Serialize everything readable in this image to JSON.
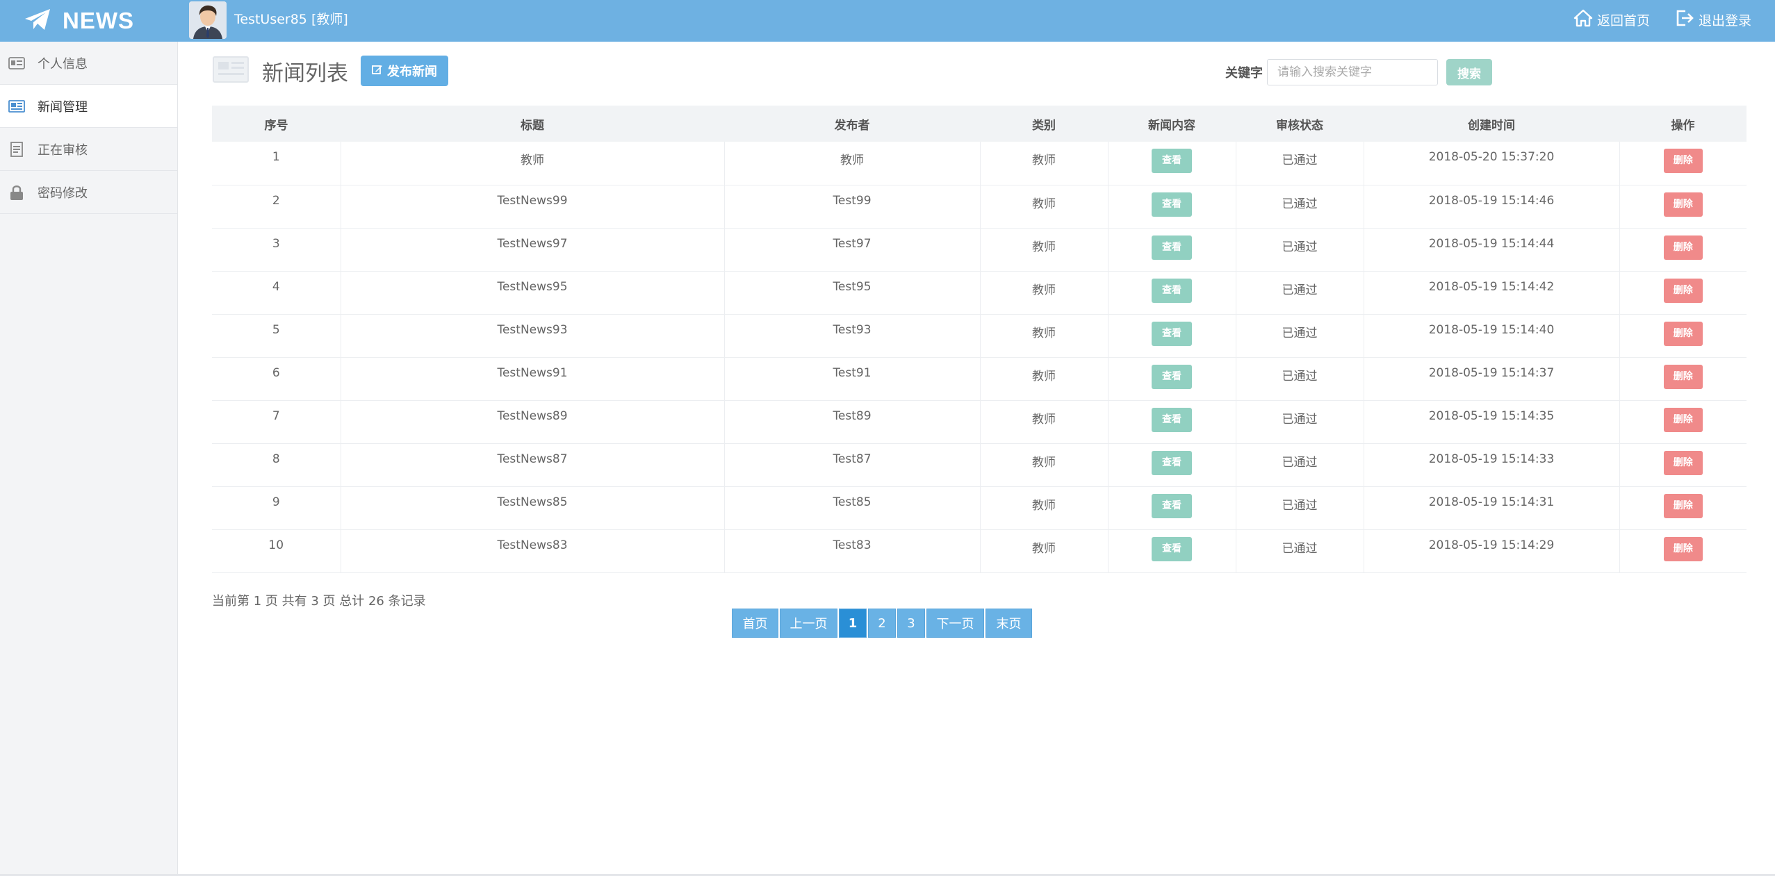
{
  "brand": {
    "name": "NEWS",
    "icon": "paper-plane-icon"
  },
  "user": {
    "label": "TestUser85 [教师]",
    "avatar_icon": "user-avatar"
  },
  "top_links": [
    {
      "label": "返回首页",
      "icon": "home-icon"
    },
    {
      "label": "退出登录",
      "icon": "logout-icon"
    }
  ],
  "sidebar": {
    "items": [
      {
        "label": "个人信息",
        "icon": "id-card-icon",
        "active": false
      },
      {
        "label": "新闻管理",
        "icon": "newspaper-icon",
        "active": true
      },
      {
        "label": "正在审核",
        "icon": "document-icon",
        "active": false
      },
      {
        "label": "密码修改",
        "icon": "lock-icon",
        "active": false
      }
    ]
  },
  "page": {
    "title": "新闻列表",
    "publish_label": "发布新闻",
    "search": {
      "label": "关键字",
      "placeholder": "请输入搜索关键字",
      "button": "搜索"
    }
  },
  "table": {
    "headers": [
      "序号",
      "标题",
      "发布者",
      "类别",
      "新闻内容",
      "审核状态",
      "创建时间",
      "操作"
    ],
    "view_label": "查看",
    "delete_label": "删除",
    "rows": [
      {
        "no": "1",
        "title": "教师",
        "author": "教师",
        "category": "教师",
        "status": "已通过",
        "created": "2018-05-20 15:37:20"
      },
      {
        "no": "2",
        "title": "TestNews99",
        "author": "Test99",
        "category": "教师",
        "status": "已通过",
        "created": "2018-05-19 15:14:46"
      },
      {
        "no": "3",
        "title": "TestNews97",
        "author": "Test97",
        "category": "教师",
        "status": "已通过",
        "created": "2018-05-19 15:14:44"
      },
      {
        "no": "4",
        "title": "TestNews95",
        "author": "Test95",
        "category": "教师",
        "status": "已通过",
        "created": "2018-05-19 15:14:42"
      },
      {
        "no": "5",
        "title": "TestNews93",
        "author": "Test93",
        "category": "教师",
        "status": "已通过",
        "created": "2018-05-19 15:14:40"
      },
      {
        "no": "6",
        "title": "TestNews91",
        "author": "Test91",
        "category": "教师",
        "status": "已通过",
        "created": "2018-05-19 15:14:37"
      },
      {
        "no": "7",
        "title": "TestNews89",
        "author": "Test89",
        "category": "教师",
        "status": "已通过",
        "created": "2018-05-19 15:14:35"
      },
      {
        "no": "8",
        "title": "TestNews87",
        "author": "Test87",
        "category": "教师",
        "status": "已通过",
        "created": "2018-05-19 15:14:33"
      },
      {
        "no": "9",
        "title": "TestNews85",
        "author": "Test85",
        "category": "教师",
        "status": "已通过",
        "created": "2018-05-19 15:14:31"
      },
      {
        "no": "10",
        "title": "TestNews83",
        "author": "Test83",
        "category": "教师",
        "status": "已通过",
        "created": "2018-05-19 15:14:29"
      }
    ]
  },
  "pagination": {
    "summary": "当前第 1 页 共有 3 页 总计 26 条记录",
    "first": "首页",
    "prev": "上一页",
    "pages": [
      "1",
      "2",
      "3"
    ],
    "current": "1",
    "next": "下一页",
    "last": "末页"
  },
  "colors": {
    "topbar": "#6eb1e2",
    "primary_button": "#62aee4",
    "view_button": "#91d0c1",
    "delete_button": "#f08a8a",
    "pager_current": "#2a8fd6"
  }
}
